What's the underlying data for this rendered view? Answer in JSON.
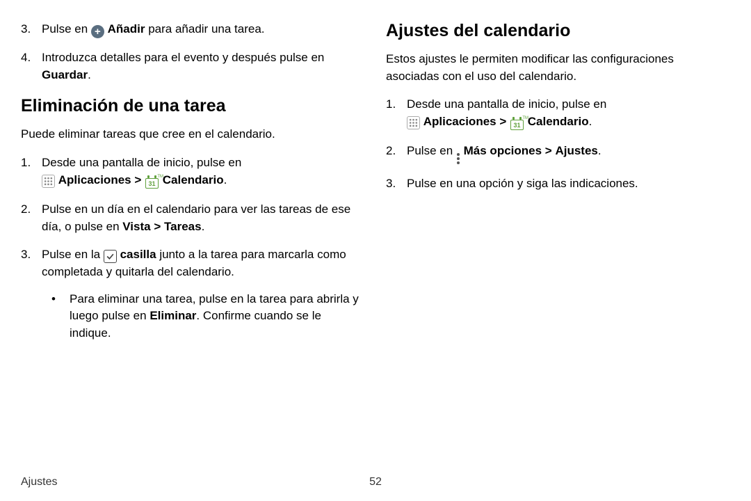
{
  "left": {
    "continued_list": {
      "i3": {
        "num": "3.",
        "t1": "Pulse en",
        "addLabel": "Añadir",
        "t2": "para añadir una tarea."
      },
      "i4": {
        "num": "4.",
        "t1": "Introduzca detalles para el evento y después pulse en",
        "bold": "Guardar",
        "period": "."
      }
    },
    "heading": "Eliminación de una tarea",
    "intro": "Puede eliminar tareas que cree en el calendario.",
    "steps": {
      "s1": {
        "num": "1.",
        "t1": "Desde una pantalla de inicio, pulse en",
        "apps": "Aplicaciones",
        "chev": ">",
        "cal": "Calendario",
        "period": "."
      },
      "s2": {
        "num": "2.",
        "t1": "Pulse en un día en el calendario para ver las tareas de ese día, o pulse en",
        "vista": "Vista",
        "chev": ">",
        "tareas": "Tareas",
        "period": "."
      },
      "s3": {
        "num": "3.",
        "t1": "Pulse en la",
        "casilla": "casilla",
        "t2": "junto a la tarea para marcarla como completada y quitarla del calendario.",
        "sub": {
          "bullet": "•",
          "t1": "Para eliminar una tarea, pulse en la tarea para abrirla y luego pulse en",
          "eliminar": "Eliminar",
          "t2": ". Confirme cuando se le indique."
        }
      }
    }
  },
  "right": {
    "heading": "Ajustes del calendario",
    "intro": "Estos ajustes le permiten modificar las configuraciones asociadas con el uso del calendario.",
    "steps": {
      "s1": {
        "num": "1.",
        "t1": "Desde una pantalla de inicio, pulse en",
        "apps": "Aplicaciones",
        "chev": ">",
        "cal": "Calendario",
        "period": "."
      },
      "s2": {
        "num": "2.",
        "t1": "Pulse en",
        "more": "Más opciones",
        "chev": ">",
        "ajustes": "Ajustes",
        "period": "."
      },
      "s3": {
        "num": "3.",
        "t1": "Pulse en una opción y siga las indicaciones."
      }
    }
  },
  "footer": {
    "section": "Ajustes",
    "page": "52"
  },
  "icons": {
    "calDay": "31"
  }
}
